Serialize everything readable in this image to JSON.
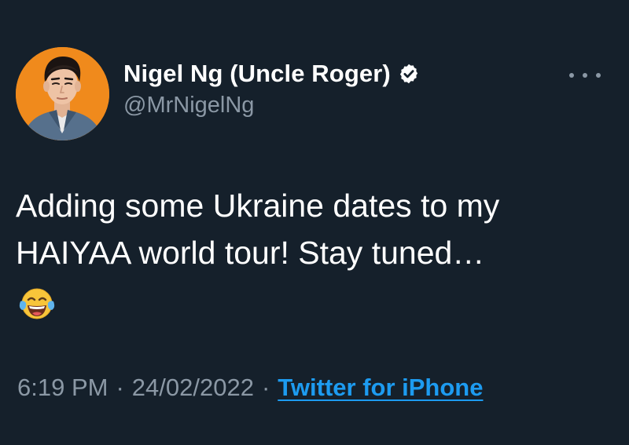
{
  "tweet": {
    "author": {
      "display_name": "Nigel Ng (Uncle Roger)",
      "handle": "@MrNigelNg",
      "verified": true,
      "avatar": "profile-photo"
    },
    "text_lines": [
      "Adding some Ukraine dates to my",
      "HAIYAA world tour! Stay tuned…"
    ],
    "emoji": "face-with-tears-of-joy",
    "time": "6:19 PM",
    "date": "24/02/2022",
    "separator": "·",
    "source": "Twitter for iPhone"
  },
  "icons": {
    "more": "more-horizontal-icon",
    "verified": "verified-badge-icon"
  },
  "colors": {
    "background": "#15202b",
    "primary_text": "#ffffff",
    "secondary_text": "#8b98a5",
    "link": "#1d9bf0",
    "avatar_bg": "#f08a1c"
  }
}
